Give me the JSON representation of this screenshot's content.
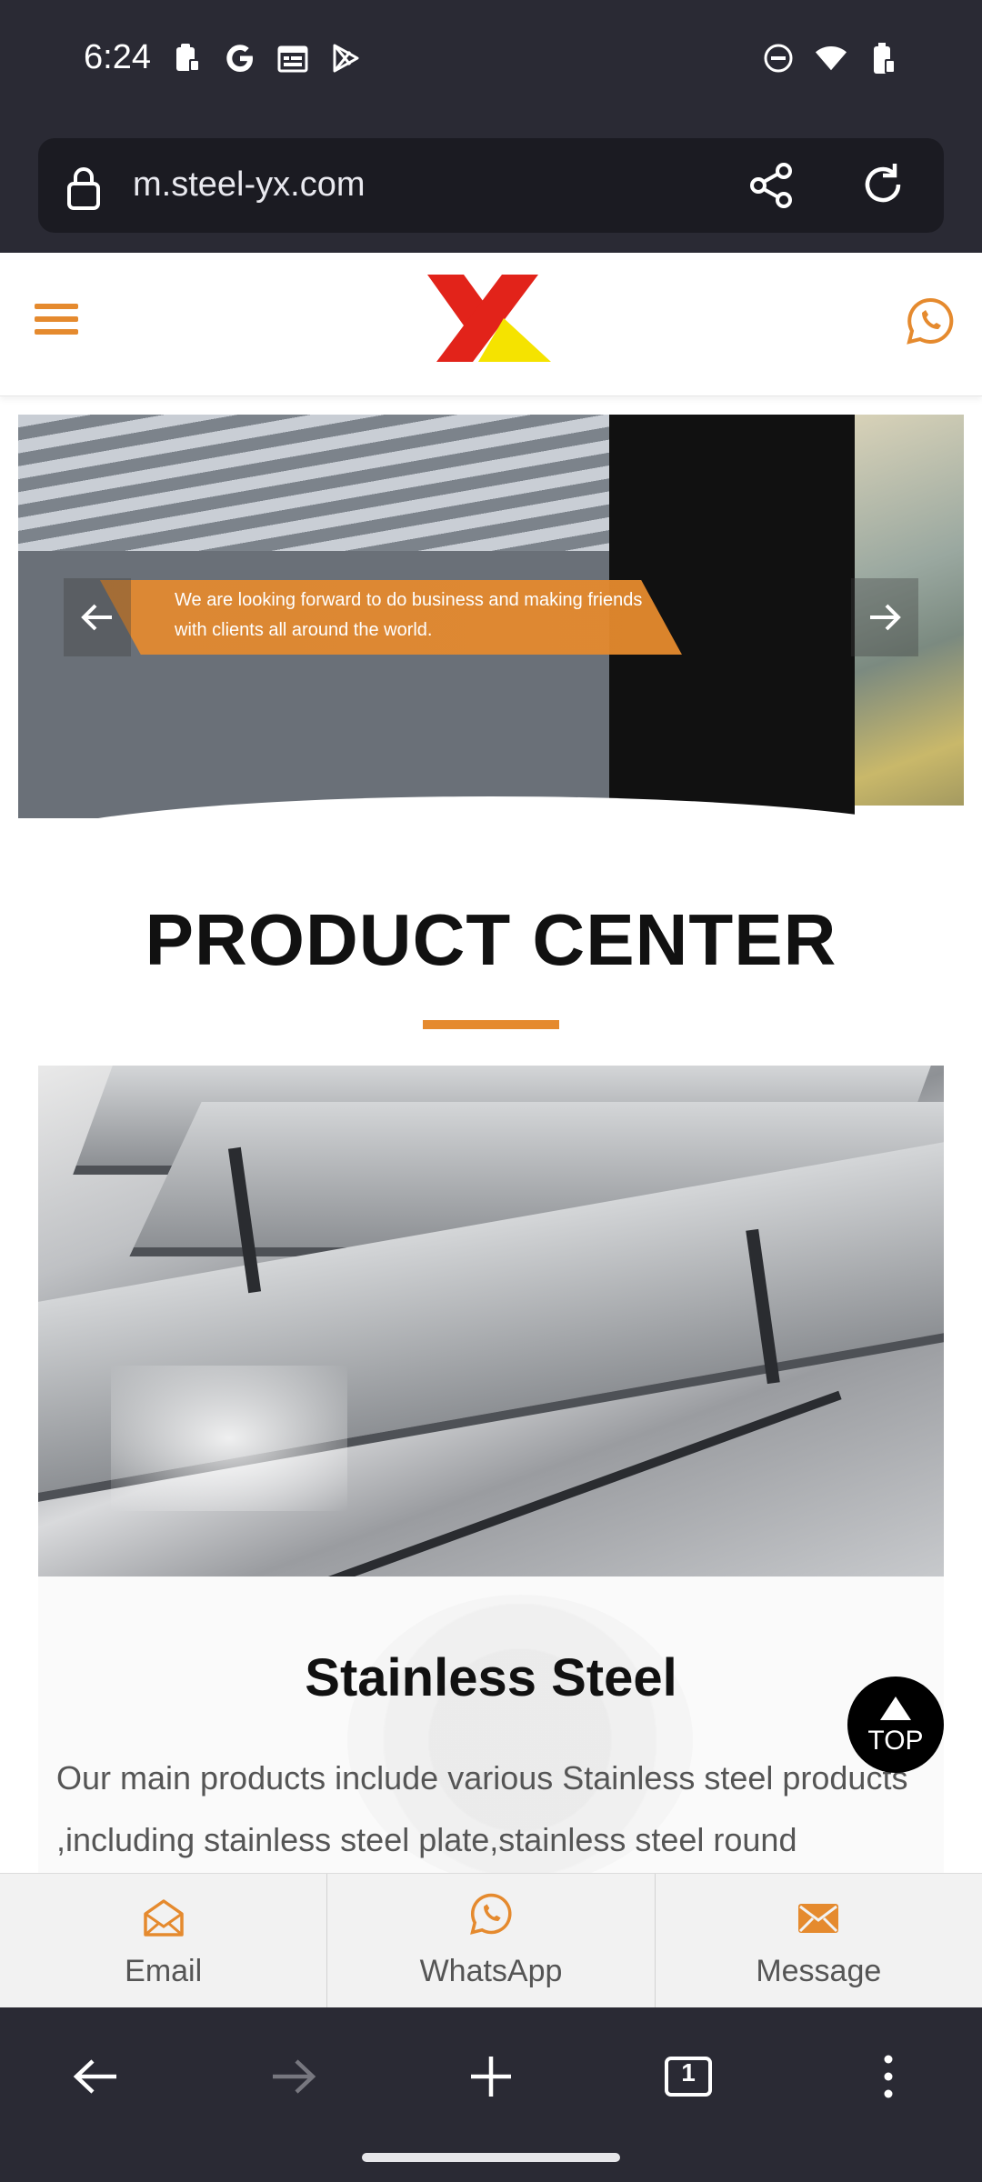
{
  "status_bar": {
    "time": "6:24",
    "left_icons": [
      "clipboard-icon",
      "google-icon",
      "calendar-icon",
      "play-store-icon"
    ],
    "right_icons": [
      "do-not-disturb-icon",
      "wifi-icon",
      "battery-icon"
    ]
  },
  "browser": {
    "url": "m.steel-yx.com"
  },
  "hero": {
    "caption": "We are looking forward to do business and making friends with clients all around the world."
  },
  "product_center": {
    "title": "PRODUCT CENTER",
    "product_name": "Stainless Steel",
    "product_desc": "Our main products include various Stainless steel products ,including stainless steel plate,stainless steel round"
  },
  "top_button": {
    "label": "TOP"
  },
  "contact_bar": {
    "email": "Email",
    "whatsapp": "WhatsApp",
    "message": "Message"
  },
  "colors": {
    "accent": "#e58a2e",
    "logo_red": "#e2231a",
    "logo_yellow": "#f5e300",
    "chrome": "#2a2a34"
  },
  "nav_bar": {
    "tab_count": "1"
  }
}
